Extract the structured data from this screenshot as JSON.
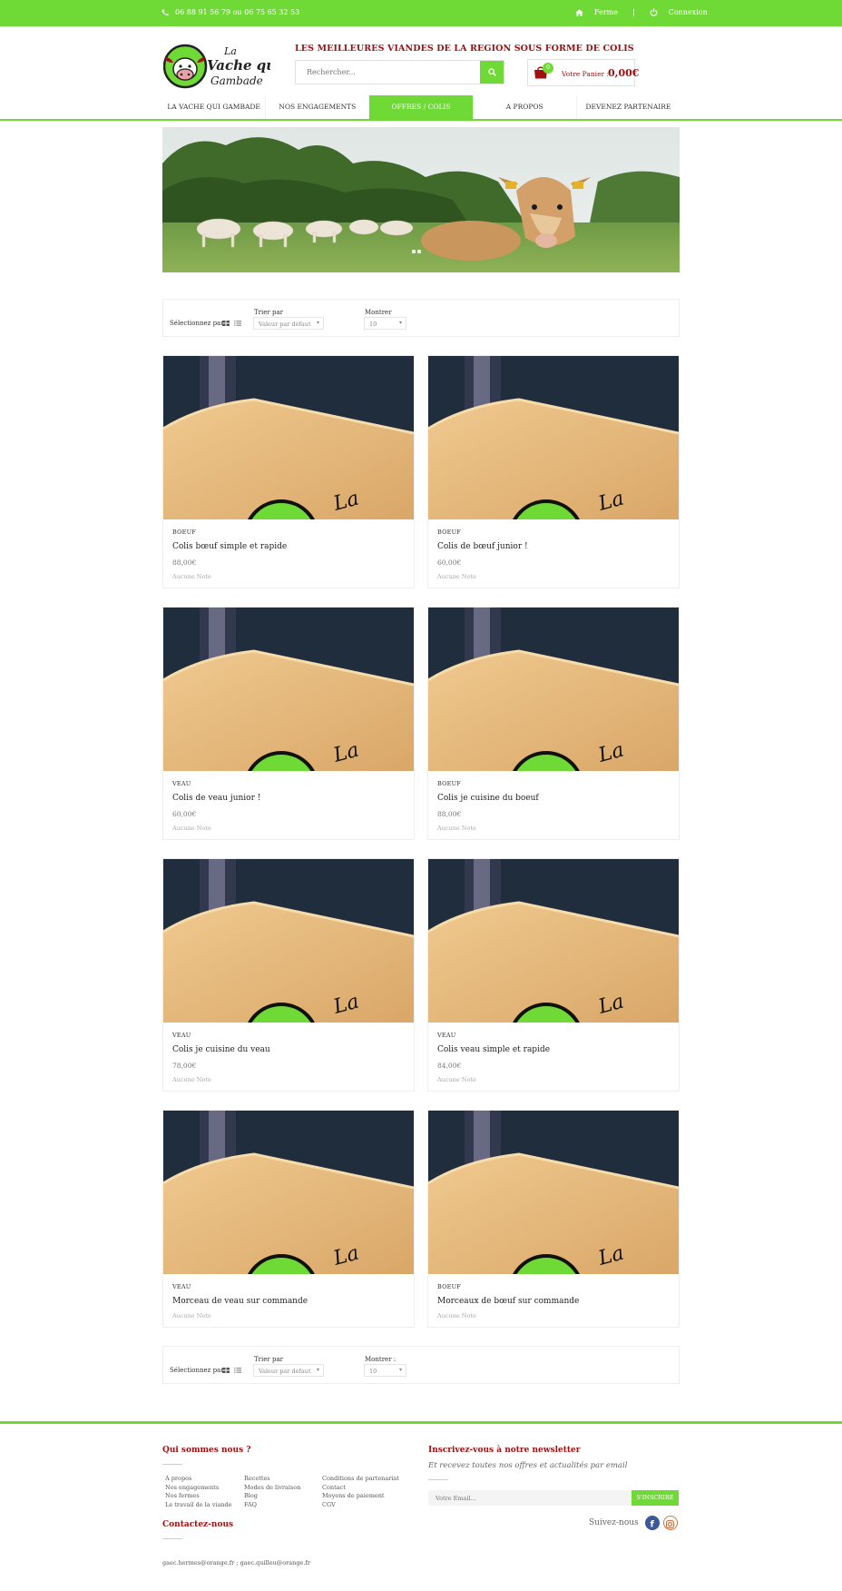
{
  "topbar": {
    "phone": "06 88 91 56 79 ou 06 75 65 32 53",
    "home_label": "Ferme",
    "login_label": "Connexion"
  },
  "header": {
    "logo_line1": "La",
    "logo_line2": "Vache qui",
    "logo_line3": "Gambade",
    "tagline": "LES MEILLEURES VIANDES DE LA REGION SOUS FORME DE COLIS",
    "search_placeholder": "Rechercher...",
    "cart_count": "0",
    "cart_label": "Votre Panier :",
    "cart_amount": "0,00€"
  },
  "nav": {
    "items": [
      {
        "label": "LA VACHE QUI GAMBADE"
      },
      {
        "label": "NOS ENGAGEMENTS"
      },
      {
        "label": "OFFRES / COLIS"
      },
      {
        "label": "A PROPOS"
      },
      {
        "label": "DEVENEZ PARTENAIRE"
      }
    ]
  },
  "toolbar_top": {
    "select_label": "Sélectionnez par :",
    "sort_label": "Trier par",
    "sort_value": "Valeur par défaut",
    "show_label": "Montrer",
    "show_value": "10"
  },
  "toolbar_bottom": {
    "select_label": "Sélectionnez par :",
    "sort_label": "Trier par",
    "sort_value": "Valeur par défaut",
    "show_label": "Montrer :",
    "show_value": "10"
  },
  "products": [
    {
      "category": "BOEUF",
      "title": "Colis bœuf simple et rapide",
      "price": "88,00€",
      "rating": "Aucune Note"
    },
    {
      "category": "BOEUF",
      "title": "Colis de bœuf junior !",
      "price": "60,00€",
      "rating": "Aucune Note"
    },
    {
      "category": "VEAU",
      "title": "Colis de veau junior !",
      "price": "60,00€",
      "rating": "Aucune Note"
    },
    {
      "category": "BOEUF",
      "title": "Colis je cuisine du boeuf",
      "price": "88,00€",
      "rating": "Aucune Note"
    },
    {
      "category": "VEAU",
      "title": "Colis je cuisine du veau",
      "price": "78,00€",
      "rating": "Aucune Note"
    },
    {
      "category": "VEAU",
      "title": "Colis veau simple et rapide",
      "price": "84,00€",
      "rating": "Aucune Note"
    },
    {
      "category": "VEAU",
      "title": "Morceau de veau sur commande",
      "price": "",
      "rating": "Aucune Note"
    },
    {
      "category": "BOEUF",
      "title": "Morceaux de bœuf sur commande",
      "price": "",
      "rating": "Aucune Note"
    }
  ],
  "footer": {
    "about_title": "Qui sommes nous ?",
    "col1": [
      "A propos",
      "Nos engagements",
      "Nos fermes",
      "Le travail de la viande"
    ],
    "col2": [
      "Recettes",
      "Modes de livraison",
      "Blog",
      "FAQ"
    ],
    "col3": [
      "Conditions de partenariat",
      "Contact",
      "Moyens de paiement",
      "CGV"
    ],
    "contact_title": "Contactez-nous",
    "email": "gaec.hermes@orange.fr ; gaec.quilleu@orange.fr",
    "news_title": "Inscrivez-vous à notre newsletter",
    "news_sub": "Et recevez toutes nos offres et actualités par email",
    "news_placeholder": "Votre Email...",
    "news_button": "S'INSCRIRE",
    "follow_label": "Suivez-nous"
  },
  "colors": {
    "accent": "#6fd936",
    "brand_red": "#a01010"
  }
}
